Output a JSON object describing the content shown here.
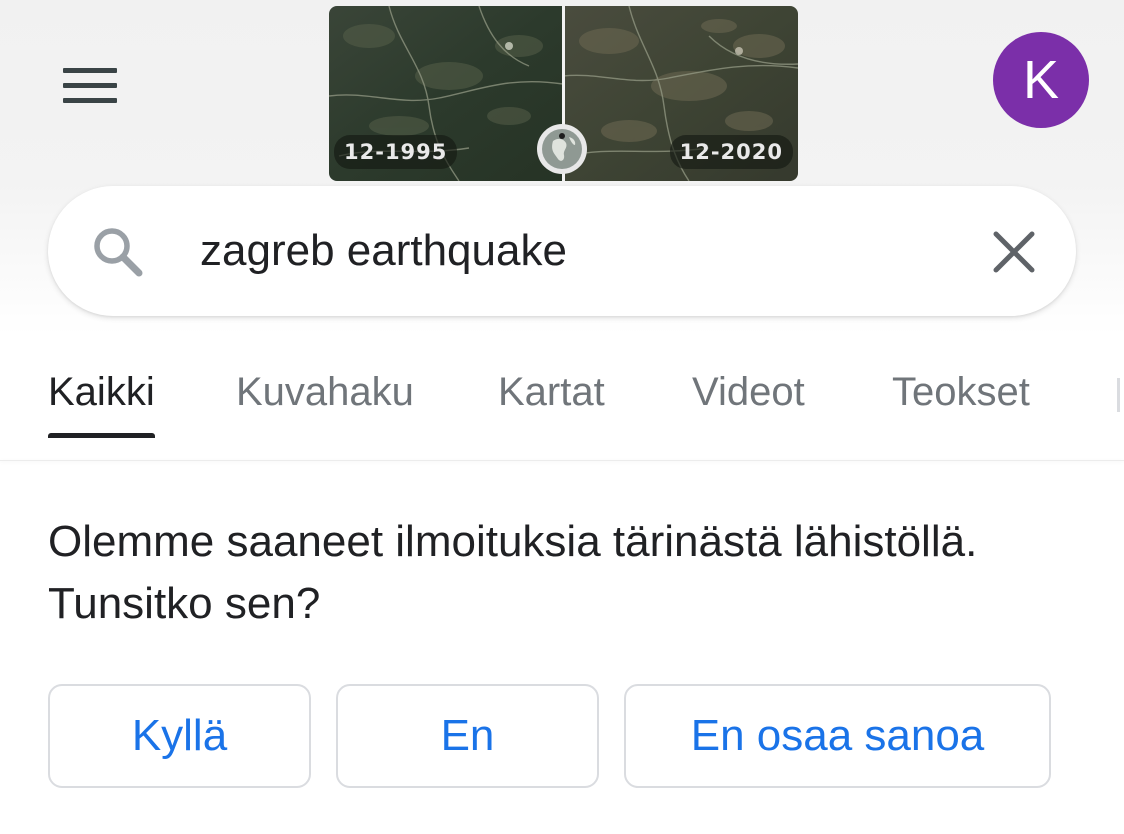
{
  "header": {
    "menu_icon": "hamburger-menu-icon",
    "doodle": {
      "date_left": "12-1995",
      "date_right": "12-2020",
      "globe_icon": "globe-icon"
    },
    "avatar_letter": "K",
    "avatar_color": "#7b2fa9"
  },
  "search": {
    "icon": "search-icon",
    "query": "zagreb earthquake",
    "clear_icon": "close-icon"
  },
  "tabs": [
    {
      "label": "Kaikki",
      "active": true
    },
    {
      "label": "Kuvahaku",
      "active": false
    },
    {
      "label": "Kartat",
      "active": false
    },
    {
      "label": "Videot",
      "active": false
    },
    {
      "label": "Teokset",
      "active": false
    }
  ],
  "prompt": {
    "text": "Olemme saaneet ilmoituksia tärinästä lähistöllä. Tunsitko sen?"
  },
  "answers": [
    {
      "label": "Kyllä"
    },
    {
      "label": "En"
    },
    {
      "label": "En osaa sanoa"
    }
  ],
  "colors": {
    "link_blue": "#1a73e8",
    "text_dark": "#202124",
    "text_gray": "#70757a"
  }
}
